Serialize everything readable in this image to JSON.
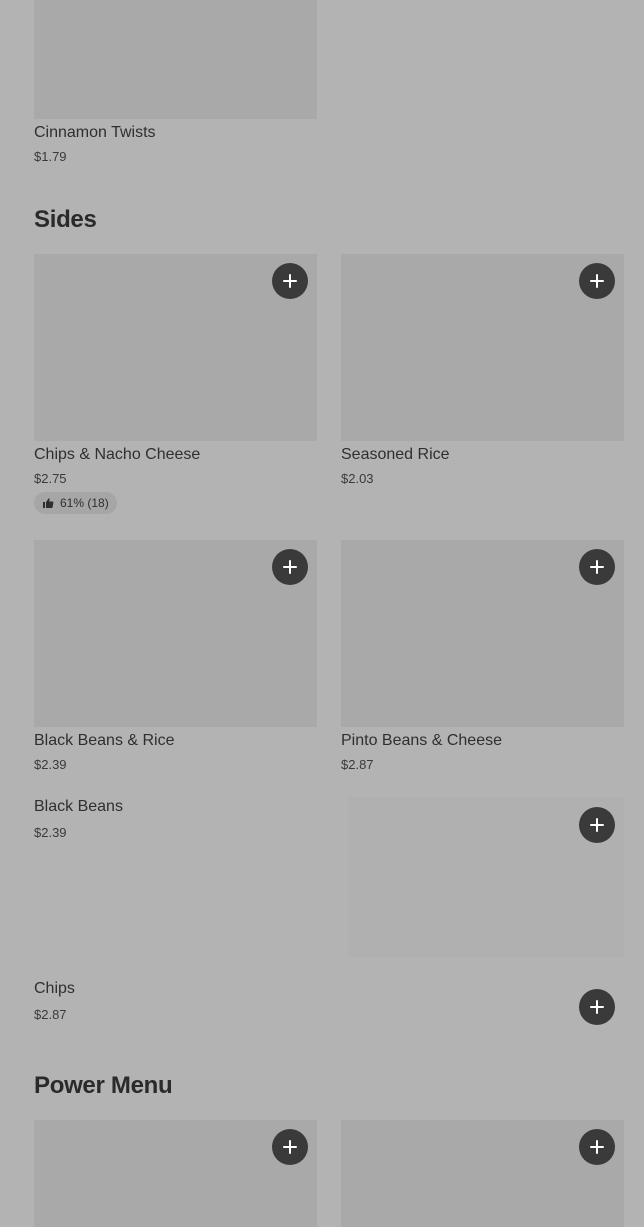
{
  "top_item": {
    "name": "Cinnamon Twists",
    "price": "$1.79"
  },
  "sections": {
    "sides_title": "Sides",
    "power_title": "Power Menu"
  },
  "sides": {
    "chips_nacho": {
      "name": "Chips & Nacho Cheese",
      "price": "$2.75",
      "rating": "61% (18)"
    },
    "seasoned_rice": {
      "name": "Seasoned Rice",
      "price": "$2.03"
    },
    "black_beans_rice": {
      "name": "Black Beans & Rice",
      "price": "$2.39"
    },
    "pinto_beans": {
      "name": "Pinto Beans & Cheese",
      "price": "$2.87"
    },
    "black_beans": {
      "name": "Black Beans",
      "price": "$2.39"
    },
    "chips": {
      "name": "Chips",
      "price": "$2.87"
    }
  },
  "icons": {
    "add": "plus-icon",
    "rating": "thumbs-up-icon"
  },
  "colors": {
    "background": "#b3b3b3",
    "image_placeholder": "#a9a9a9",
    "add_button": "#3a3a3a"
  }
}
